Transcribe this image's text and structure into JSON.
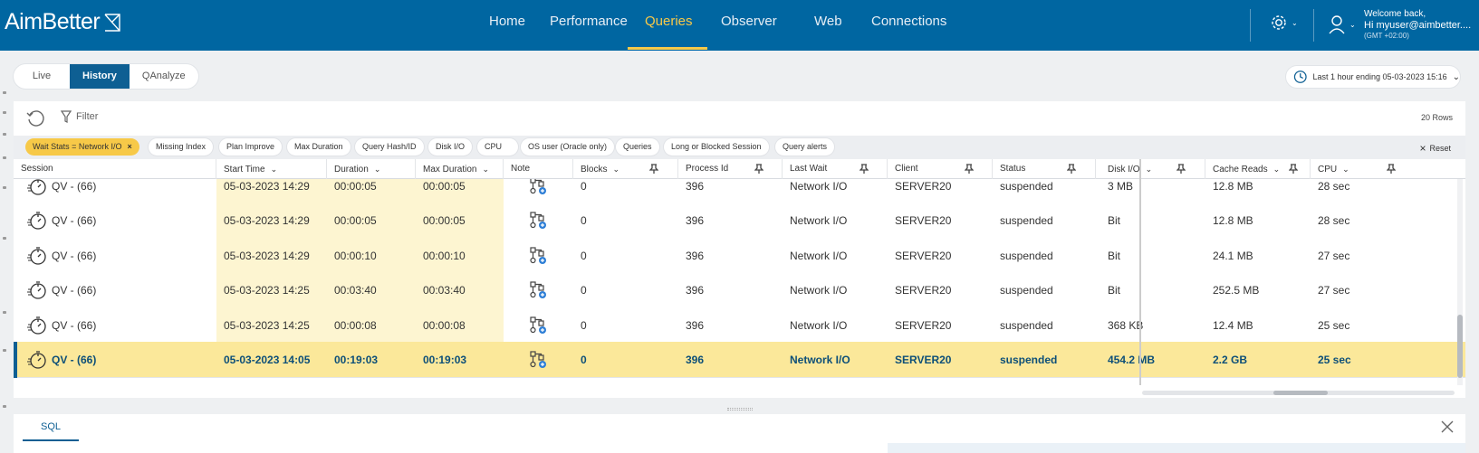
{
  "brand": {
    "name": "AimBetter"
  },
  "nav": {
    "items": [
      {
        "label": "Home",
        "active": false
      },
      {
        "label": "Performance",
        "active": false
      },
      {
        "label": "Queries",
        "active": true
      },
      {
        "label": "Observer",
        "active": false
      },
      {
        "label": "Web",
        "active": false
      },
      {
        "label": "Connections",
        "active": false
      }
    ]
  },
  "user": {
    "welcome": "Welcome back,",
    "greeting": "Hi myuser@aimbetter....",
    "timezone": "(GMT +02:00)"
  },
  "modes": {
    "live": "Live",
    "history": "History",
    "qanalyze": "QAnalyze",
    "active": "History"
  },
  "time_range": {
    "label": "Last 1 hour ending  05-03-2023 15:16"
  },
  "toolbar": {
    "filter_label": "Filter",
    "rows_count": "20 Rows"
  },
  "chips": {
    "items": [
      {
        "label": "Wait Stats = Network I/O",
        "active": true
      },
      {
        "label": "Missing Index",
        "active": false
      },
      {
        "label": "Plan Improve",
        "active": false
      },
      {
        "label": "Max Duration",
        "active": false
      },
      {
        "label": "Query Hash/ID",
        "active": false
      },
      {
        "label": "Disk I/O",
        "active": false
      },
      {
        "label": "CPU",
        "active": false
      },
      {
        "label": "OS user (Oracle only)",
        "active": false
      },
      {
        "label": "Queries",
        "active": false
      },
      {
        "label": "Long or Blocked Session",
        "active": false
      },
      {
        "label": "Query alerts",
        "active": false
      }
    ],
    "reset_label": "Reset"
  },
  "table": {
    "columns": [
      "Session",
      "Start Time",
      "Duration",
      "Max Duration",
      "Note",
      "Blocks",
      "Process Id",
      "Last Wait",
      "Client",
      "Status",
      "Disk I/O",
      "Cache Reads",
      "CPU"
    ],
    "rows": [
      {
        "session": "QV - (66)",
        "start": "05-03-2023 14:29",
        "duration": "00:00:05",
        "max": "00:00:05",
        "blocks": "0",
        "pid": "396",
        "wait": "Network I/O",
        "client": "SERVER20",
        "status": "suspended",
        "disk": "3 MB",
        "cache": "12.8 MB",
        "cpu": "28 sec",
        "selected": false
      },
      {
        "session": "QV - (66)",
        "start": "05-03-2023 14:29",
        "duration": "00:00:05",
        "max": "00:00:05",
        "blocks": "0",
        "pid": "396",
        "wait": "Network I/O",
        "client": "SERVER20",
        "status": "suspended",
        "disk": "Bit",
        "cache": "12.8 MB",
        "cpu": "28 sec",
        "selected": false
      },
      {
        "session": "QV - (66)",
        "start": "05-03-2023 14:29",
        "duration": "00:00:10",
        "max": "00:00:10",
        "blocks": "0",
        "pid": "396",
        "wait": "Network I/O",
        "client": "SERVER20",
        "status": "suspended",
        "disk": "Bit",
        "cache": "24.1 MB",
        "cpu": "27 sec",
        "selected": false
      },
      {
        "session": "QV - (66)",
        "start": "05-03-2023 14:25",
        "duration": "00:03:40",
        "max": "00:03:40",
        "blocks": "0",
        "pid": "396",
        "wait": "Network I/O",
        "client": "SERVER20",
        "status": "suspended",
        "disk": "Bit",
        "cache": "252.5 MB",
        "cpu": "27 sec",
        "selected": false
      },
      {
        "session": "QV - (66)",
        "start": "05-03-2023 14:25",
        "duration": "00:00:08",
        "max": "00:00:08",
        "blocks": "0",
        "pid": "396",
        "wait": "Network I/O",
        "client": "SERVER20",
        "status": "suspended",
        "disk": "368 KB",
        "cache": "12.4 MB",
        "cpu": "25 sec",
        "selected": false
      },
      {
        "session": "QV - (66)",
        "start": "05-03-2023 14:05",
        "duration": "00:19:03",
        "max": "00:19:03",
        "blocks": "0",
        "pid": "396",
        "wait": "Network I/O",
        "client": "SERVER20",
        "status": "suspended",
        "disk": "454.2 MB",
        "cache": "2.2 GB",
        "cpu": "25 sec",
        "selected": true
      }
    ]
  },
  "bottom_panel": {
    "tab": "SQL"
  },
  "colors": {
    "header_bg": "#0066a1",
    "accent": "#f7c948",
    "selected_row": "#fbe89a",
    "highlight_col": "#fdf5d1",
    "primary": "#0e5f93"
  }
}
